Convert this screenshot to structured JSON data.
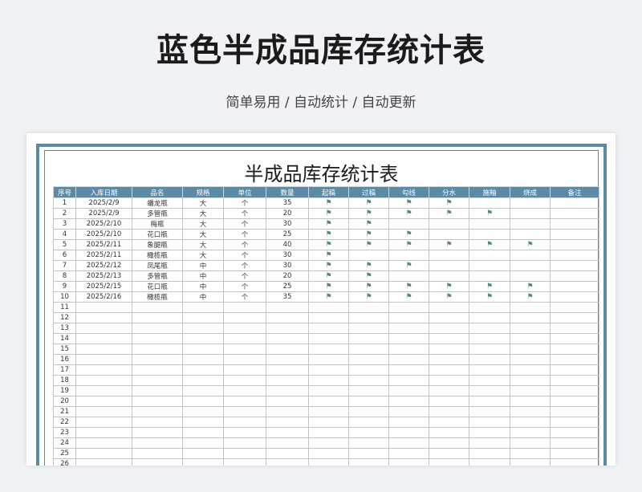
{
  "header": {
    "title": "蓝色半成品库存统计表",
    "subtitle": "简单易用 / 自动统计 / 自动更新"
  },
  "sheet": {
    "title": "半成品库存统计表",
    "columns": [
      "序号",
      "入库日期",
      "品名",
      "规格",
      "单位",
      "数量",
      "起稿",
      "过稿",
      "勾线",
      "分水",
      "施釉",
      "烧成",
      "备注"
    ],
    "flag_symbol": "⚑",
    "rows": [
      {
        "no": "1",
        "date": "2025/2/9",
        "name": "蟠龙瓶",
        "spec": "大",
        "unit": "个",
        "qty": "35",
        "flags": [
          1,
          1,
          1,
          1,
          0,
          0
        ]
      },
      {
        "no": "2",
        "date": "2025/2/9",
        "name": "多管瓶",
        "spec": "大",
        "unit": "个",
        "qty": "20",
        "flags": [
          1,
          1,
          1,
          1,
          1,
          0
        ]
      },
      {
        "no": "3",
        "date": "2025/2/10",
        "name": "梅瓶",
        "spec": "大",
        "unit": "个",
        "qty": "30",
        "flags": [
          1,
          1,
          0,
          0,
          0,
          0
        ]
      },
      {
        "no": "4",
        "date": "2025/2/10",
        "name": "花口瓶",
        "spec": "大",
        "unit": "个",
        "qty": "25",
        "flags": [
          1,
          1,
          1,
          0,
          0,
          0
        ]
      },
      {
        "no": "5",
        "date": "2025/2/11",
        "name": "象腿瓶",
        "spec": "大",
        "unit": "个",
        "qty": "40",
        "flags": [
          1,
          1,
          1,
          1,
          1,
          1
        ]
      },
      {
        "no": "6",
        "date": "2025/2/11",
        "name": "橄榄瓶",
        "spec": "大",
        "unit": "个",
        "qty": "30",
        "flags": [
          1,
          0,
          0,
          0,
          0,
          0
        ]
      },
      {
        "no": "7",
        "date": "2025/2/12",
        "name": "凤尾瓶",
        "spec": "中",
        "unit": "个",
        "qty": "30",
        "flags": [
          1,
          1,
          1,
          0,
          0,
          0
        ]
      },
      {
        "no": "8",
        "date": "2025/2/13",
        "name": "多管瓶",
        "spec": "中",
        "unit": "个",
        "qty": "20",
        "flags": [
          1,
          1,
          0,
          0,
          0,
          0
        ]
      },
      {
        "no": "9",
        "date": "2025/2/15",
        "name": "花口瓶",
        "spec": "中",
        "unit": "个",
        "qty": "25",
        "flags": [
          1,
          1,
          1,
          1,
          1,
          1
        ]
      },
      {
        "no": "10",
        "date": "2025/2/16",
        "name": "橄榄瓶",
        "spec": "中",
        "unit": "个",
        "qty": "35",
        "flags": [
          1,
          1,
          1,
          1,
          1,
          1
        ]
      }
    ],
    "empty_rows": [
      "11",
      "12",
      "13",
      "14",
      "15",
      "16",
      "17",
      "18",
      "19",
      "20",
      "21",
      "22",
      "23",
      "24",
      "25",
      "26"
    ]
  },
  "colors": {
    "accent": "#5a8aa6",
    "flag": "#4f8a78",
    "background": "#f0f2f5"
  }
}
